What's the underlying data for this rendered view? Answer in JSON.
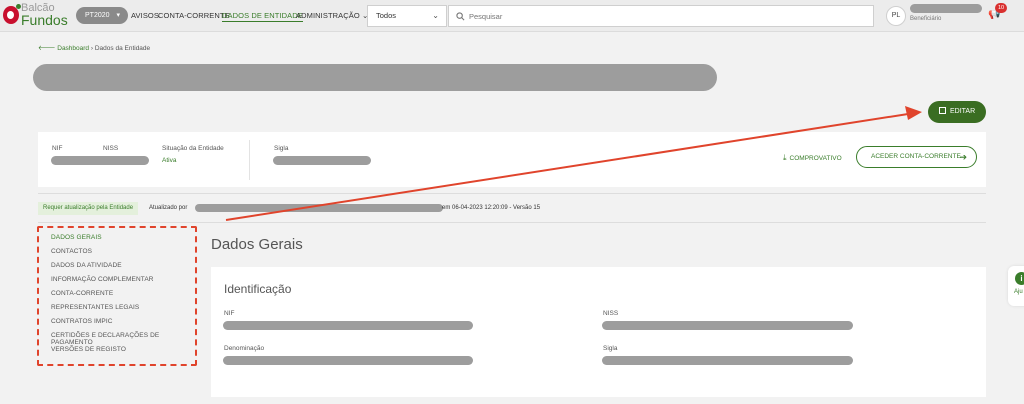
{
  "brand": {
    "line1": "Balcão",
    "line2": "Fundos"
  },
  "topbar": {
    "program": "PT2020",
    "nav": [
      "AVISOS",
      "CONTA-CORRENTE",
      "DADOS DE ENTIDADE",
      "ADMINISTRAÇÃO"
    ],
    "filter_value": "Todos",
    "search_placeholder": "Pesquisar",
    "user_initials": "PL",
    "user_role": "Beneficiário",
    "notifications_count": "10"
  },
  "breadcrumb": {
    "home": "Dashboard",
    "current": "Dados da Entidade"
  },
  "actions": {
    "edit": "EDITAR",
    "comprovativo": "COMPROVATIVO",
    "aceder": "ACEDER CONTA-CORRENTE"
  },
  "entity": {
    "nif_label": "NIF",
    "niss_label": "NISS",
    "situacao_label": "Situação da Entidade",
    "situacao_value": "Ativa",
    "sigla_label": "Sigla"
  },
  "status": {
    "requires_update": "Requer atualização pela Entidade",
    "updated_by_label": "Atualizado por",
    "updated_suffix": "em 06-04-2023 12:20:09 - Versão 15"
  },
  "sidemenu": [
    "DADOS GERAIS",
    "CONTACTOS",
    "DADOS DA ATIVIDADE",
    "INFORMAÇÃO COMPLEMENTAR",
    "CONTA-CORRENTE",
    "REPRESENTANTES LEGAIS",
    "CONTRATOS IMPIC",
    "CERTIDÕES E DECLARAÇÕES DE PAGAMENTO",
    "VERSÕES DE REGISTO"
  ],
  "main": {
    "section_title": "Dados Gerais",
    "card_title": "Identificação",
    "fields": [
      "NIF",
      "NISS",
      "Denominação",
      "Sigla"
    ]
  },
  "help": {
    "label": "Aju"
  },
  "colors": {
    "brand_green": "#3a7d2b",
    "edit_green": "#3a6d22",
    "annotation_red": "#e0442c",
    "redacted_gray": "#9d9d9d"
  }
}
